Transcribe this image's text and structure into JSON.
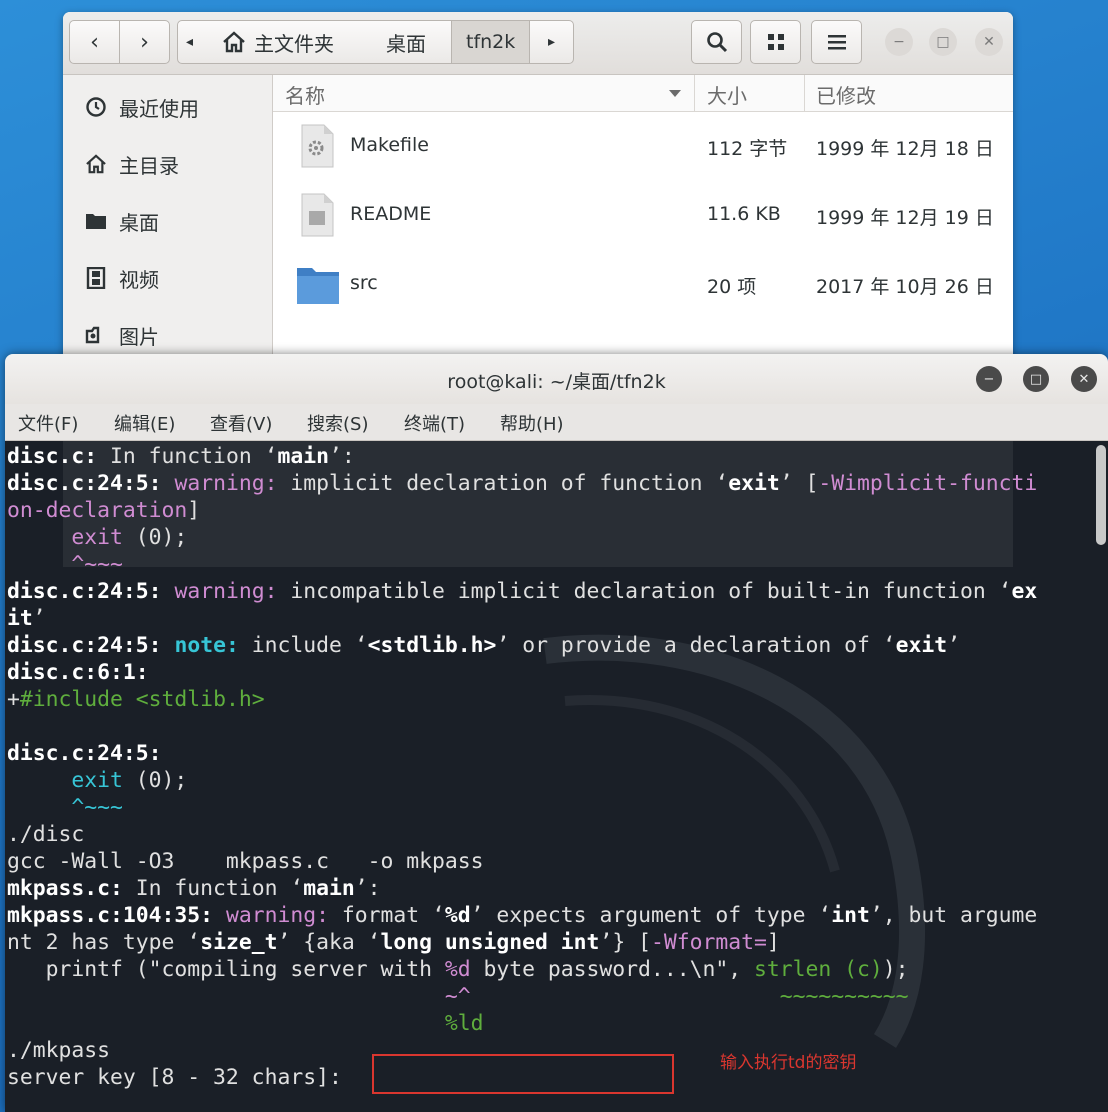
{
  "file_manager": {
    "nav": {
      "back_icon": "chevron-left-icon",
      "forward_icon": "chevron-right-icon"
    },
    "breadcrumbs": [
      "主文件夹",
      "桌面",
      "tfn2k"
    ],
    "columns": {
      "name": "名称",
      "size": "大小",
      "modified": "已修改"
    },
    "sidebar": [
      {
        "icon": "clock-icon",
        "label": "最近使用"
      },
      {
        "icon": "home-icon",
        "label": "主目录"
      },
      {
        "icon": "folder-icon",
        "label": "桌面"
      },
      {
        "icon": "film-icon",
        "label": "视频"
      },
      {
        "icon": "camera-icon",
        "label": "图片"
      }
    ],
    "files": [
      {
        "name": "Makefile",
        "size": "112 字节",
        "date": "1999 年 12月 18 日",
        "icon": "script-file-icon"
      },
      {
        "name": "README",
        "size": "11.6 KB",
        "date": "1999 年 12月 19 日",
        "icon": "text-file-icon"
      },
      {
        "name": "src",
        "size": "20 项",
        "date": "2017 年 10月 26 日",
        "icon": "folder-icon"
      }
    ]
  },
  "terminal": {
    "title": "root@kali: ~/桌面/tfn2k",
    "menu": [
      "文件(F)",
      "编辑(E)",
      "查看(V)",
      "搜索(S)",
      "终端(T)",
      "帮助(H)"
    ],
    "lines": [
      [
        {
          "t": "disc.c:",
          "c": "b"
        },
        {
          "t": " In function "
        },
        {
          "t": "‘"
        },
        {
          "t": "main",
          "c": "b"
        },
        {
          "t": "’:"
        }
      ],
      [
        {
          "t": "disc.c:24:5:",
          "c": "b"
        },
        {
          "t": " "
        },
        {
          "t": "warning:",
          "c": "w"
        },
        {
          "t": " implicit declaration of function ‘"
        },
        {
          "t": "exit",
          "c": "b"
        },
        {
          "t": "’ ["
        },
        {
          "t": "-Wimplicit-functi",
          "c": "w"
        }
      ],
      [
        {
          "t": "on-declaration",
          "c": "w"
        },
        {
          "t": "]"
        }
      ],
      [
        {
          "t": "     "
        },
        {
          "t": "exit",
          "c": "w"
        },
        {
          "t": " (0);"
        }
      ],
      [
        {
          "t": "     "
        },
        {
          "t": "^~~~",
          "c": "w"
        }
      ],
      [
        {
          "t": "disc.c:24:5:",
          "c": "b"
        },
        {
          "t": " "
        },
        {
          "t": "warning:",
          "c": "w"
        },
        {
          "t": " incompatible implicit declaration of built-in function ‘"
        },
        {
          "t": "ex",
          "c": "b"
        }
      ],
      [
        {
          "t": "it",
          "c": "b"
        },
        {
          "t": "’"
        }
      ],
      [
        {
          "t": "disc.c:24:5:",
          "c": "b"
        },
        {
          "t": " "
        },
        {
          "t": "note:",
          "c": "n"
        },
        {
          "t": " include ‘"
        },
        {
          "t": "<stdlib.h>",
          "c": "b"
        },
        {
          "t": "’ or provide a declaration of ‘"
        },
        {
          "t": "exit",
          "c": "b"
        },
        {
          "t": "’"
        }
      ],
      [
        {
          "t": "disc.c:6:1:",
          "c": "b"
        }
      ],
      [
        {
          "t": "+"
        },
        {
          "t": "#include <stdlib.h>",
          "c": "g"
        }
      ],
      [
        {
          "t": ""
        }
      ],
      [
        {
          "t": "disc.c:24:5:",
          "c": "b"
        }
      ],
      [
        {
          "t": "     "
        },
        {
          "t": "exit",
          "c": "bc"
        },
        {
          "t": " (0);"
        }
      ],
      [
        {
          "t": "     "
        },
        {
          "t": "^~~~",
          "c": "bc"
        }
      ],
      [
        {
          "t": "./disc"
        }
      ],
      [
        {
          "t": "gcc -Wall -O3    mkpass.c   -o mkpass"
        }
      ],
      [
        {
          "t": "mkpass.c:",
          "c": "b"
        },
        {
          "t": " In function ‘"
        },
        {
          "t": "main",
          "c": "b"
        },
        {
          "t": "’:"
        }
      ],
      [
        {
          "t": "mkpass.c:104:35:",
          "c": "b"
        },
        {
          "t": " "
        },
        {
          "t": "warning:",
          "c": "w"
        },
        {
          "t": " format ‘"
        },
        {
          "t": "%d",
          "c": "b"
        },
        {
          "t": "’ expects argument of type ‘"
        },
        {
          "t": "int",
          "c": "b"
        },
        {
          "t": "’, but argume"
        }
      ],
      [
        {
          "t": "nt 2 has type ‘"
        },
        {
          "t": "size_t",
          "c": "b"
        },
        {
          "t": "’ {aka ‘"
        },
        {
          "t": "long unsigned int",
          "c": "b"
        },
        {
          "t": "’} ["
        },
        {
          "t": "-Wformat=",
          "c": "w"
        },
        {
          "t": "]"
        }
      ],
      [
        {
          "t": "   printf (\"compiling server with "
        },
        {
          "t": "%d",
          "c": "w"
        },
        {
          "t": " byte password...\\n\", "
        },
        {
          "t": "strlen (c)",
          "c": "g"
        },
        {
          "t": ");"
        }
      ],
      [
        {
          "t": "                                  "
        },
        {
          "t": "~^",
          "c": "w"
        },
        {
          "t": "                        "
        },
        {
          "t": "~~~~~~~~~~",
          "c": "g"
        }
      ],
      [
        {
          "t": "                                  "
        },
        {
          "t": "%ld",
          "c": "g"
        }
      ],
      [
        {
          "t": "./mkpass"
        }
      ],
      [
        {
          "t": "server key [8 - 32 chars]: "
        }
      ]
    ],
    "annotation": "输入执行td的密钥"
  }
}
